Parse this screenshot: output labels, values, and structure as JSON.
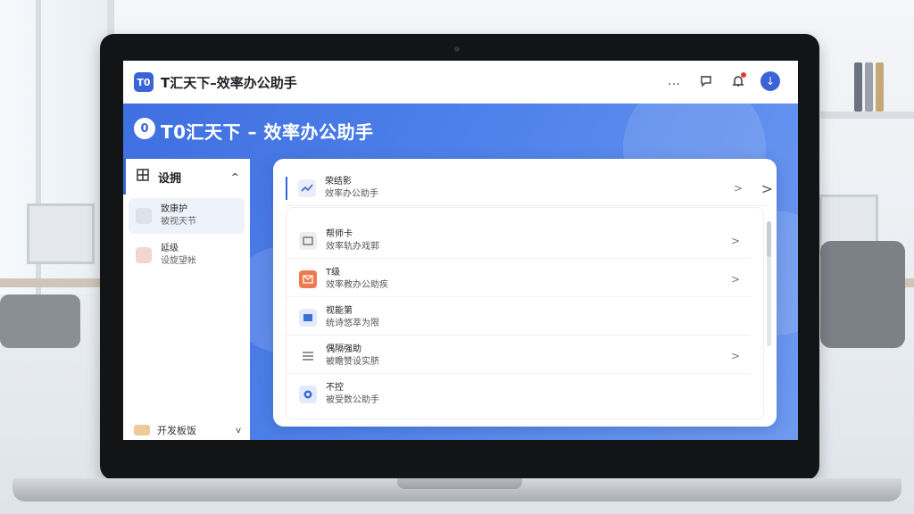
{
  "app": {
    "logo_text": "T0",
    "title": "T汇天下–效率办公助手",
    "banner_logo_text": "0",
    "banner_title": "T0汇天下 – 效率办公助手"
  },
  "toolbar": {
    "more_icon": "…",
    "chat_icon": "◌",
    "bell_icon": "🔔",
    "avatar_icon": "↓"
  },
  "sidebar": {
    "header_label": "设拥",
    "header_chevron": "^",
    "items": [
      {
        "title": "致康护",
        "subtitle": "被视天节"
      },
      {
        "title": "延级",
        "subtitle": "设旋望帐"
      }
    ],
    "footer_label": "开发板饭",
    "footer_chevron": "v"
  },
  "panel": {
    "top": {
      "title": "荣结影",
      "subtitle": "效率办公助手"
    },
    "rows": [
      {
        "title": "帮师卡",
        "subtitle": "效率轨办戏郭"
      },
      {
        "title": "T级",
        "subtitle": "效率教办公助疾"
      },
      {
        "title": "视能第",
        "subtitle": "统诗悠萃为限"
      },
      {
        "title": "偶隔强助",
        "subtitle": "被瞻赞设实脐"
      },
      {
        "title": "不控",
        "subtitle": "被受数公助手"
      }
    ],
    "chevron": ">"
  },
  "colors": {
    "accent": "#3a63d6",
    "banner_start": "#3f6fe0",
    "banner_end": "#6f9af0",
    "row_icon_orange": "#f07a4f",
    "row_icon_blue": "#3a6fd8"
  }
}
